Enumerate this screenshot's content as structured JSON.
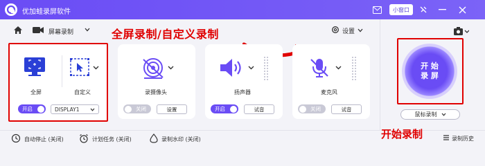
{
  "app": {
    "title": "优加蛙录屏软件",
    "mini_window": "小窗口"
  },
  "toolbar": {
    "mode_label": "屏幕录制",
    "settings_label": "设置"
  },
  "annotations": {
    "top": "全屏录制/自定义录制",
    "bottom": "开始录制"
  },
  "screen_card": {
    "fullscreen_label": "全屏",
    "custom_label": "自定义",
    "toggle_label": "开启",
    "display_value": "DISPLAY1"
  },
  "camera_card": {
    "label": "录摄像头",
    "toggle_label": "关闭",
    "settings_button": "设置"
  },
  "audio_card": {
    "label": "扬声器",
    "toggle_label": "开启",
    "test_button": "试音"
  },
  "mic_card": {
    "label": "麦克风",
    "toggle_label": "关闭",
    "test_button": "试音"
  },
  "start": {
    "line1": "开 始",
    "line2": "录 屏"
  },
  "mouse_record": {
    "label": "鼠标录制"
  },
  "bottom": {
    "auto_stop": "自动停止 (关闭)",
    "schedule": "计划任务 (关闭)",
    "watermark": "录制水印 (关闭)",
    "history": "录制历史"
  },
  "colors": {
    "accent": "#6a4cf5",
    "annotation": "#e00000"
  },
  "icons": [
    "home-icon",
    "video-camera-icon",
    "gear-icon",
    "camera-icon",
    "monitor-icon",
    "cursor-select-icon",
    "webcam-icon",
    "speaker-icon",
    "mic-muted-icon",
    "clock-icon",
    "watermark-icon",
    "history-icon"
  ]
}
